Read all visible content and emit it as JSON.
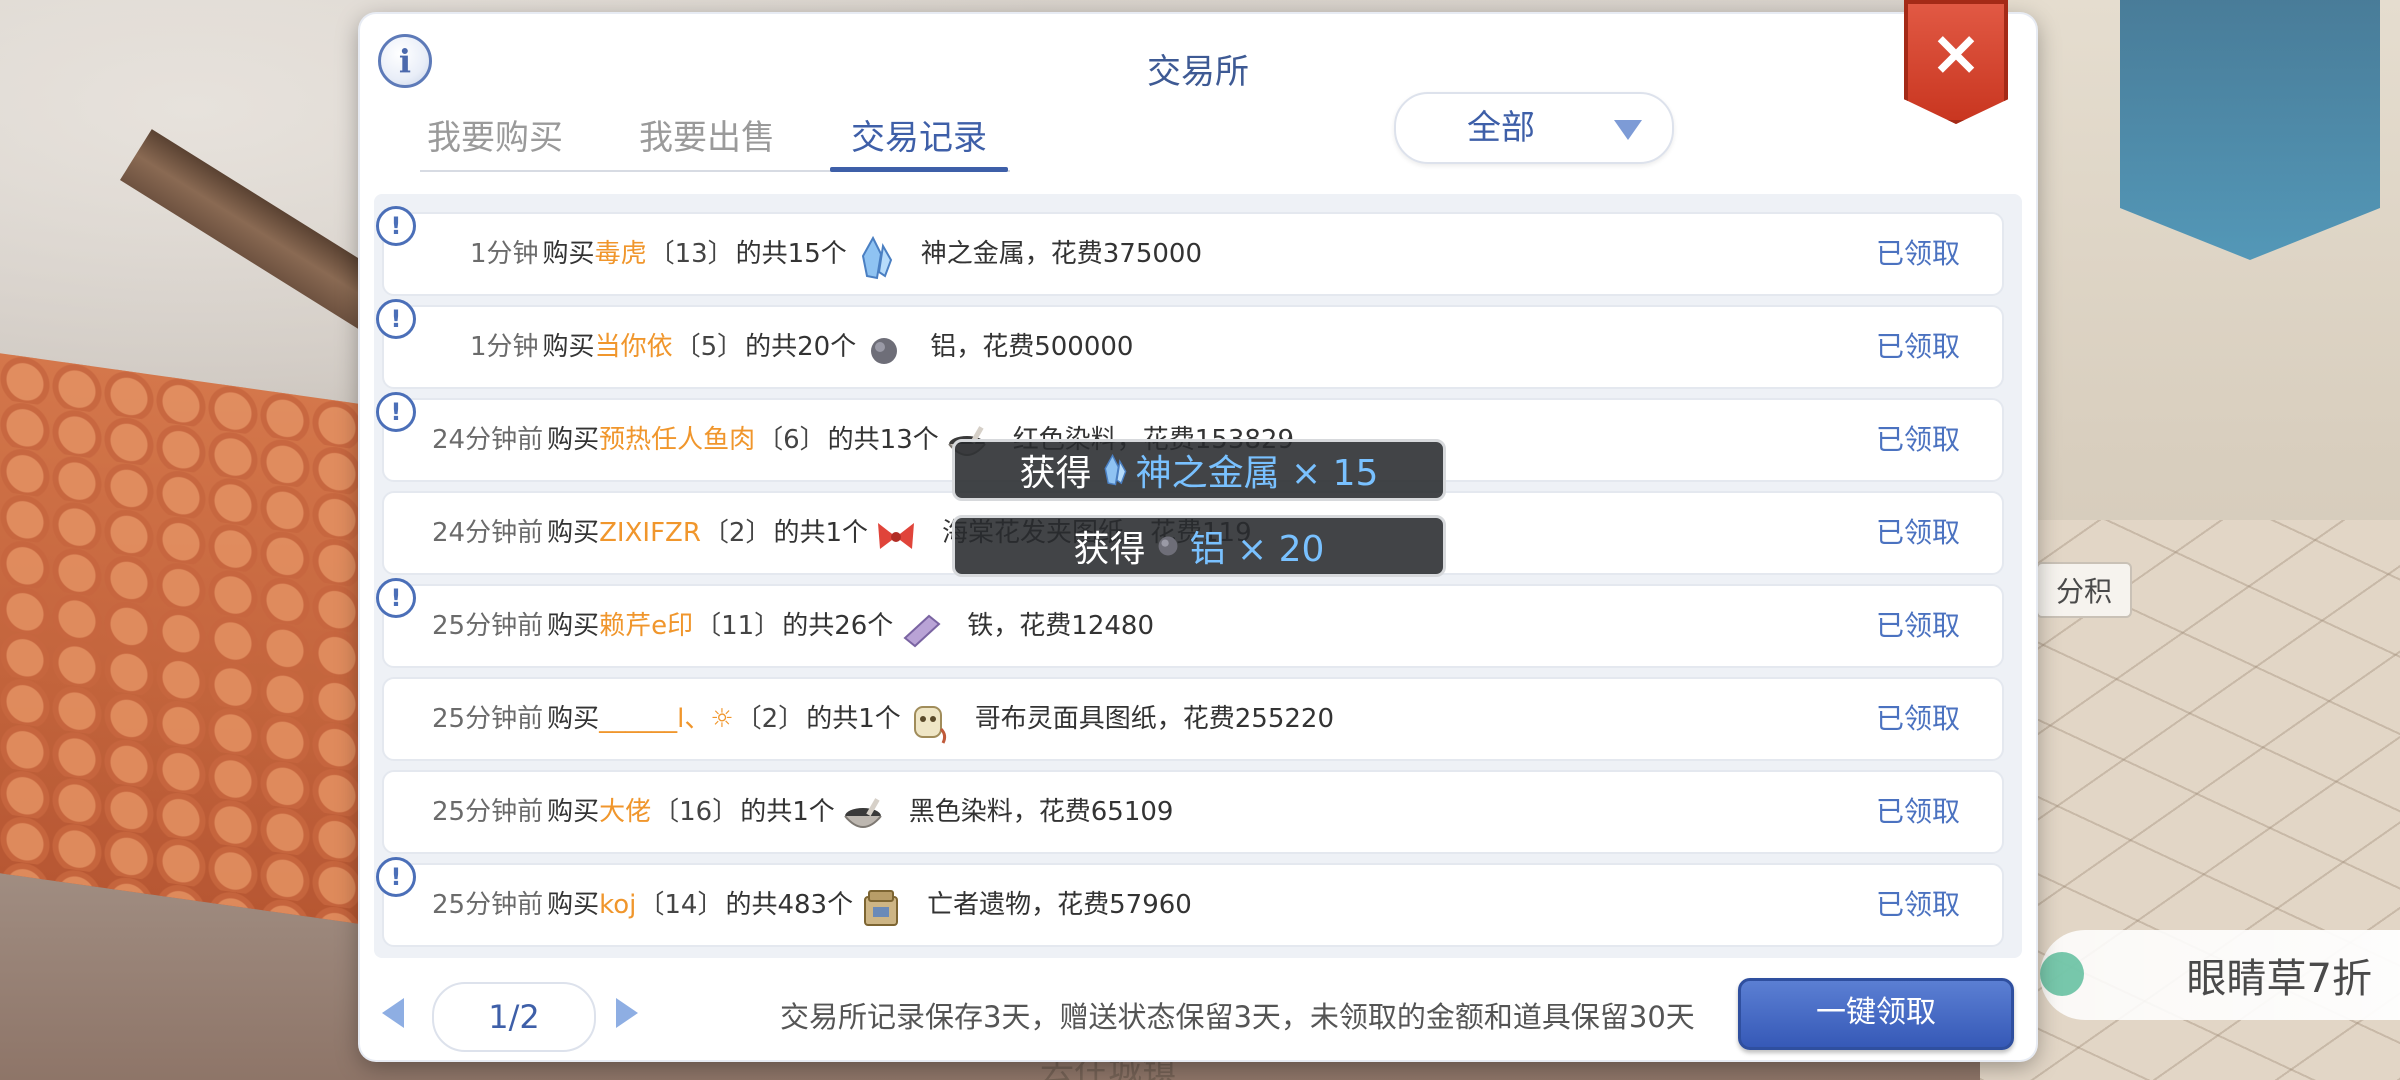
{
  "window": {
    "title": "交易所",
    "info_icon": "i",
    "close_icon": "×"
  },
  "tabs": [
    {
      "label": "我要购买",
      "active": false
    },
    {
      "label": "我要出售",
      "active": false
    },
    {
      "label": "交易记录",
      "active": true
    }
  ],
  "filter": {
    "selected": "全部"
  },
  "records": [
    {
      "time": "1分钟",
      "action": "购买",
      "seller": "毒虎",
      "level": "〔13〕",
      "qty": "的共15个",
      "item_icon": "crystal-icon",
      "item": "神之金属，花费375000",
      "status": "已领取",
      "alert": true
    },
    {
      "time": "1分钟",
      "action": "购买",
      "seller": "当你依",
      "level": "〔5〕",
      "qty": "的共20个",
      "item_icon": "ore-icon",
      "item": "铝，花费500000",
      "status": "已领取",
      "alert": true
    },
    {
      "time": "24分钟前",
      "action": "购买",
      "seller": "预热任人鱼肉",
      "level": "〔6〕",
      "qty": "的共13个",
      "item_icon": "dye-bowl-icon",
      "item": "红色染料，花费153829",
      "status": "已领取",
      "alert": true
    },
    {
      "time": "24分钟前",
      "action": "购买",
      "seller": "ZIXIFZR",
      "level": "〔2〕",
      "qty": "的共1个",
      "item_icon": "bow-icon",
      "item": "海棠花发夹图纸，花费119",
      "status": "已领取",
      "alert": false
    },
    {
      "time": "25分钟前",
      "action": "购买",
      "seller": "赖芹e印",
      "level": "〔11〕",
      "qty": "的共26个",
      "item_icon": "iron-icon",
      "item": "铁，花费12480",
      "status": "已领取",
      "alert": true
    },
    {
      "time": "25分钟前",
      "action": "购买",
      "seller": "______l、☼",
      "level": "〔2〕",
      "qty": "的共1个",
      "item_icon": "mask-icon",
      "item": "哥布灵面具图纸，花费255220",
      "status": "已领取",
      "alert": false
    },
    {
      "time": "25分钟前",
      "action": "购买",
      "seller": "大佬",
      "level": "〔16〕",
      "qty": "的共1个",
      "item_icon": "dye-bowl-icon",
      "item": "黑色染料，花费65109",
      "status": "已领取",
      "alert": false
    },
    {
      "time": "25分钟前",
      "action": "购买",
      "seller": "koj",
      "level": "〔14〕",
      "qty": "的共483个",
      "item_icon": "relic-icon",
      "item": "亡者遗物，花费57960",
      "status": "已领取",
      "alert": true
    }
  ],
  "toasts": [
    {
      "prefix": "获得",
      "item_icon": "crystal-icon",
      "item": "神之金属 × 15"
    },
    {
      "prefix": "获得",
      "item_icon": "ore-icon",
      "item": "铝 × 20"
    }
  ],
  "pager": {
    "page": "1/2"
  },
  "footer_note": "交易所记录保存3天，赠送状态保留3天，未领取的金额和道具保留30天",
  "claim_all_label": "一键领取",
  "background": {
    "chip_text": "分积",
    "promo_text": "眼睛草7折",
    "bottom_text": "去往城镇"
  },
  "colors": {
    "accent": "#3e5fa8",
    "seller": "#f0962c",
    "status": "#4b72c0",
    "toast_item": "#79c1ff"
  }
}
